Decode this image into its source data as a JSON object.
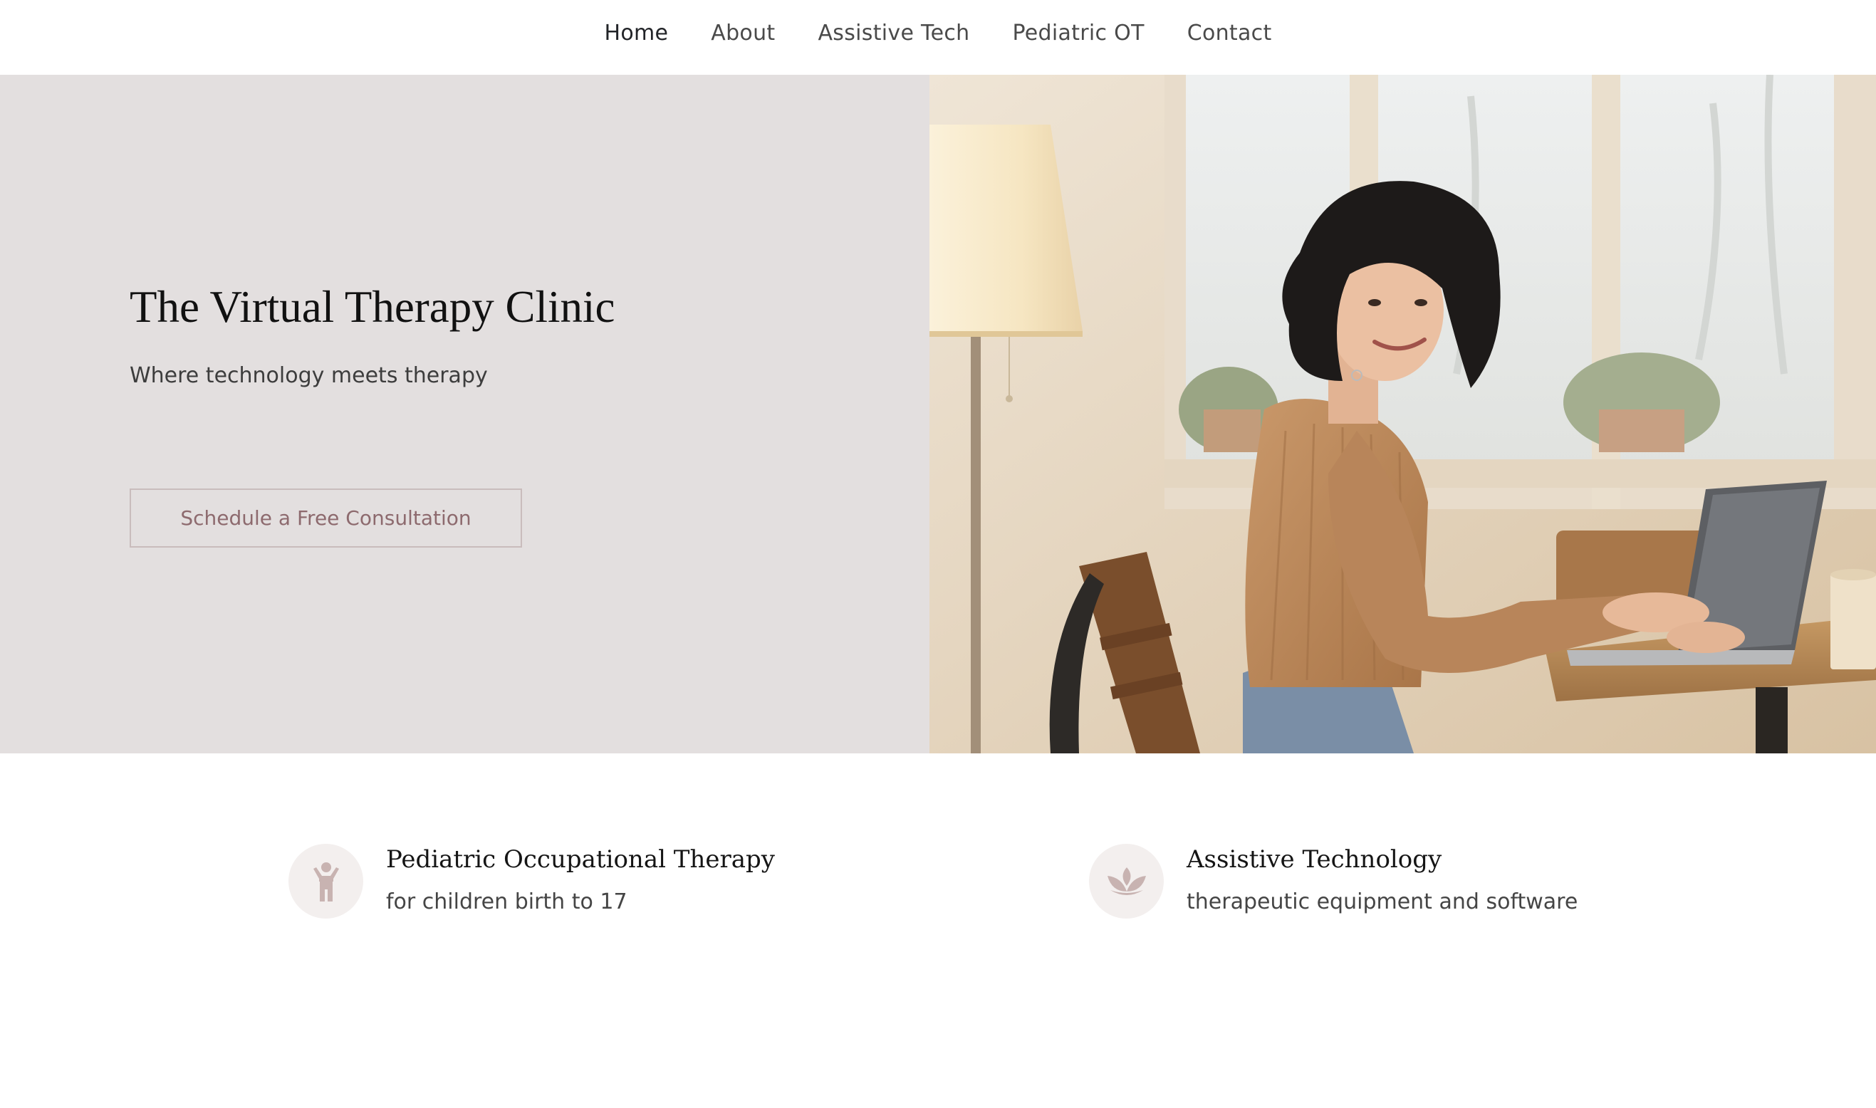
{
  "nav": {
    "items": [
      {
        "label": "Home",
        "active": true
      },
      {
        "label": "About",
        "active": false
      },
      {
        "label": "Assistive Tech",
        "active": false
      },
      {
        "label": "Pediatric OT",
        "active": false
      },
      {
        "label": "Contact",
        "active": false
      }
    ]
  },
  "hero": {
    "title": "The Virtual Therapy Clinic",
    "subtitle": "Where technology meets therapy",
    "cta_label": "Schedule a Free Consultation",
    "image_icon": "photo-woman-at-laptop"
  },
  "features": [
    {
      "title": "Pediatric Occupational Therapy",
      "description": "for children birth to 17",
      "icon": "child-icon"
    },
    {
      "title": "Assistive Technology",
      "description": "therapeutic equipment and software",
      "icon": "lotus-icon"
    }
  ],
  "colors": {
    "hero_background": "#e3dfdf",
    "accent": "#8d6a6e",
    "icon_circle": "#f3efee",
    "icon_fill": "#c8b3b1"
  }
}
